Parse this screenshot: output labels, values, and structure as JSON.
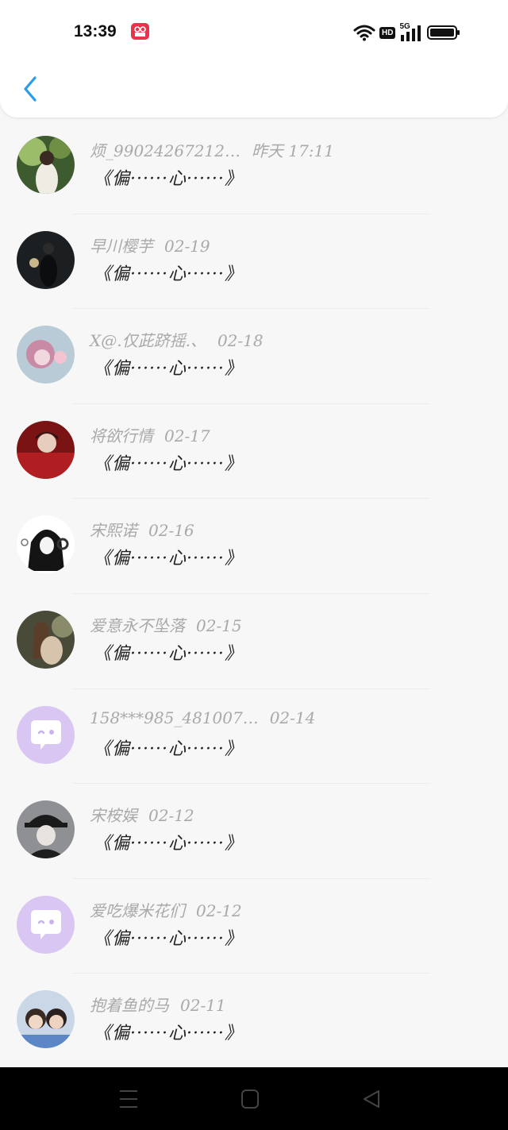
{
  "status_bar": {
    "time": "13:39",
    "network_label": "5G",
    "hd_label": "HD"
  },
  "messages": [
    {
      "name": "烦_99024267212…",
      "date": "昨天 17:11",
      "preview": "《偏······心······》"
    },
    {
      "name": "早川樱芋",
      "date": "02-19",
      "preview": "《偏······心······》"
    },
    {
      "name": "X@.仅茈跻摇.、",
      "date": "02-18",
      "preview": "《偏······心······》"
    },
    {
      "name": "将欲行情",
      "date": "02-17",
      "preview": "《偏······心······》"
    },
    {
      "name": "宋熙诺",
      "date": "02-16",
      "preview": "《偏······心······》"
    },
    {
      "name": "爱意永不坠落",
      "date": "02-15",
      "preview": "《偏······心······》"
    },
    {
      "name": "158***985_481007…",
      "date": "02-14",
      "preview": "《偏······心······》"
    },
    {
      "name": "宋桉娱",
      "date": "02-12",
      "preview": "《偏······心······》"
    },
    {
      "name": "爱吃爆米花们",
      "date": "02-12",
      "preview": "《偏······心······》"
    },
    {
      "name": "抱着鱼的马",
      "date": "02-11",
      "preview": "《偏······心······》"
    }
  ],
  "colors": {
    "back_arrow": "#2a9ee8",
    "default_avatar": "#d9c6f2",
    "name_text": "#a9a9a9",
    "preview_text": "#222222"
  }
}
